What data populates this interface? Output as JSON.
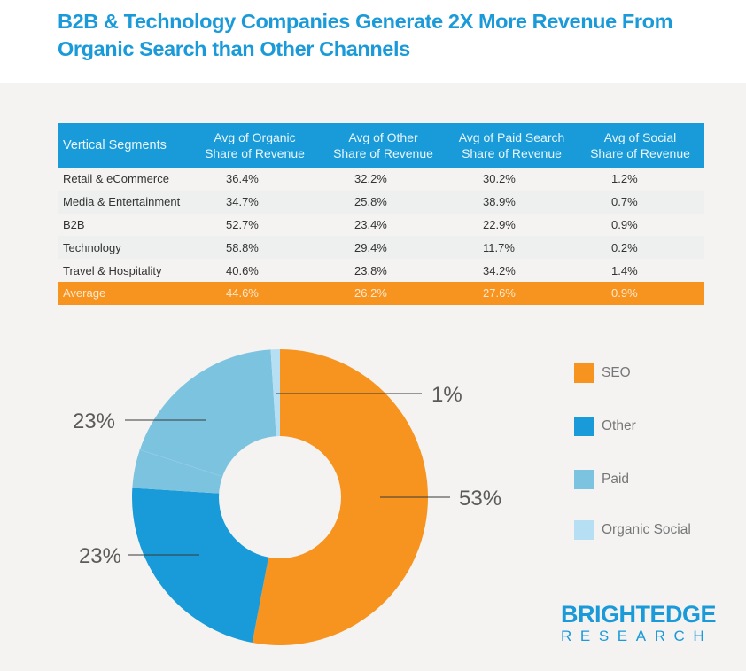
{
  "title": "B2B & Technology Companies Generate 2X More Revenue From Organic Search than Other Channels",
  "table": {
    "headers": [
      "Vertical Segments",
      "Avg of Organic Share of Revenue",
      "Avg of Other Share of Revenue",
      "Avg of Paid Search Share of Revenue",
      "Avg of Social Share of Revenue"
    ],
    "header_lines": [
      [
        "Vertical Segments"
      ],
      [
        "Avg of Organic",
        "Share of Revenue"
      ],
      [
        "Avg of Other",
        "Share of Revenue"
      ],
      [
        "Avg of Paid Search",
        "Share of Revenue"
      ],
      [
        "Avg of Social",
        "Share of Revenue"
      ]
    ],
    "rows": [
      [
        "Retail & eCommerce",
        "36.4%",
        "32.2%",
        "30.2%",
        "1.2%"
      ],
      [
        "Media & Entertainment",
        "34.7%",
        "25.8%",
        "38.9%",
        "0.7%"
      ],
      [
        "B2B",
        "52.7%",
        "23.4%",
        "22.9%",
        "0.9%"
      ],
      [
        "Technology",
        "58.8%",
        "29.4%",
        "11.7%",
        "0.2%"
      ],
      [
        "Travel & Hospitality",
        "40.6%",
        "23.8%",
        "34.2%",
        "1.4%"
      ]
    ],
    "average_row": [
      "Average",
      "44.6%",
      "26.2%",
      "27.6%",
      "0.9%"
    ]
  },
  "colors": {
    "seo": "#f7941f",
    "other": "#189bd8",
    "paid": "#7cc3e0",
    "organic_social": "#b7dff4",
    "title": "#1a9ad9",
    "callout_line": "#3a3a3a"
  },
  "chart_data": {
    "type": "pie",
    "variant": "donut",
    "title": "",
    "start": "12 o'clock, clockwise",
    "slices": [
      {
        "name": "SEO",
        "value": 53,
        "label": "53%",
        "color": "#f7941f"
      },
      {
        "name": "Other",
        "value": 23,
        "label": "23%",
        "color": "#189bd8"
      },
      {
        "name": "Paid",
        "value": 23,
        "label": "23%",
        "color": "#7cc3e0"
      },
      {
        "name": "Organic Social",
        "value": 1,
        "label": "1%",
        "color": "#b7dff4"
      }
    ],
    "legend": {
      "placement": "right",
      "entries": [
        "SEO",
        "Other",
        "Paid",
        "Organic Social"
      ]
    }
  },
  "brand": {
    "name": "BRIGHTEDGE",
    "subtitle": "RESEARCH"
  }
}
